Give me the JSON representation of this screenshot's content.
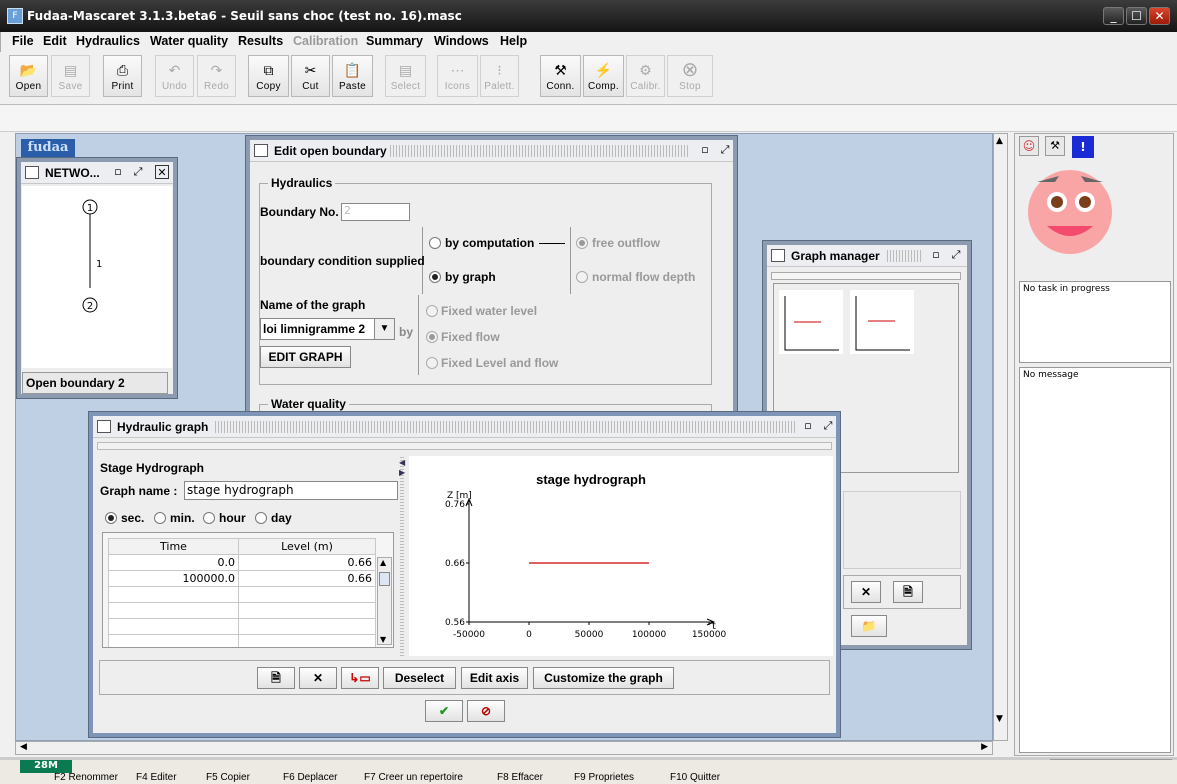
{
  "window": {
    "title": "Fudaa-Mascaret 3.1.3.beta6 - Seuil sans choc (test no. 16).masc",
    "minimize": "_",
    "maximize": "☐",
    "close": "✕"
  },
  "menu": [
    {
      "label": "File",
      "disabled": false
    },
    {
      "label": "Edit",
      "disabled": false
    },
    {
      "label": "Hydraulics",
      "disabled": false
    },
    {
      "label": "Water quality",
      "disabled": false
    },
    {
      "label": "Results",
      "disabled": false
    },
    {
      "label": "Calibration",
      "disabled": true
    },
    {
      "label": "Summary",
      "disabled": false
    },
    {
      "label": "Windows",
      "disabled": false
    },
    {
      "label": "Help",
      "disabled": false
    }
  ],
  "toolbar": {
    "open": "Open",
    "save": "Save",
    "print": "Print",
    "undo": "Undo",
    "redo": "Redo",
    "copy": "Copy",
    "cut": "Cut",
    "paste": "Paste",
    "select": "Select",
    "icons": "Icons",
    "palett": "Palett.",
    "conn": "Conn.",
    "comp": "Comp.",
    "calibr": "Calibr.",
    "stop": "Stop"
  },
  "network": {
    "title": "NETWO...",
    "node1": "1",
    "node2": "2",
    "reach": "1",
    "selection": "Open boundary 2",
    "logo": "fudaa"
  },
  "edit_boundary": {
    "title": "Edit open boundary",
    "hydraulics": "Hydraulics",
    "boundary_no_label": "Boundary No.",
    "boundary_no_value": "2",
    "supplied_label": "boundary condition supplied",
    "by_computation": "by computation",
    "by_graph": "by graph",
    "free_outflow": "free outflow",
    "normal_flow_depth": "normal flow depth",
    "graph_name_label": "Name of the graph",
    "graph_selected": "loi limnigramme 2",
    "by": "by",
    "edit_graph": "EDIT GRAPH",
    "fixed_water_level": "Fixed water level",
    "fixed_flow": "Fixed flow",
    "fixed_level_flow": "Fixed Level and flow",
    "water_quality": "Water quality"
  },
  "graph_manager": {
    "title": "Graph manager"
  },
  "hydraulic_graph": {
    "title": "Hydraulic graph",
    "stage_hydrograph": "Stage Hydrograph",
    "graph_name_label": "Graph name :",
    "graph_name_value": "stage hydrograph",
    "units": {
      "sec": "sec.",
      "min": "min.",
      "hour": "hour",
      "day": "day"
    },
    "columns": [
      "Time",
      "Level (m)"
    ],
    "rows": [
      [
        "0.0",
        "0.66"
      ],
      [
        "100000.0",
        "0.66"
      ],
      [
        "",
        ""
      ],
      [
        "",
        ""
      ],
      [
        "",
        ""
      ],
      [
        "",
        ""
      ]
    ],
    "deselect": "Deselect",
    "edit_axis": "Edit axis",
    "customize": "Customize the graph"
  },
  "chart_data": {
    "type": "line",
    "title": "stage hydrograph",
    "ylabel": "Z [m]",
    "xlabel": "t",
    "xlim": [
      -50000,
      150000
    ],
    "ylim": [
      0.56,
      0.76
    ],
    "xticks": [
      "-50000",
      "0",
      "50000",
      "100000",
      "150000"
    ],
    "yticks": [
      "0.56",
      "0.66",
      "0.76"
    ],
    "series": [
      {
        "x": [
          0,
          100000
        ],
        "y": [
          0.66,
          0.66
        ],
        "color": "#cc0000"
      }
    ]
  },
  "status": {
    "task": "No task in progress",
    "message": "No message"
  },
  "memory": "28M",
  "taskbar": [
    "F2 Renommer",
    "F4 Editer",
    "F5 Copier",
    "F6 Deplacer",
    "F7 Creer un repertoire",
    "F8 Effacer",
    "F9 Proprietes",
    "F10 Quitter"
  ]
}
